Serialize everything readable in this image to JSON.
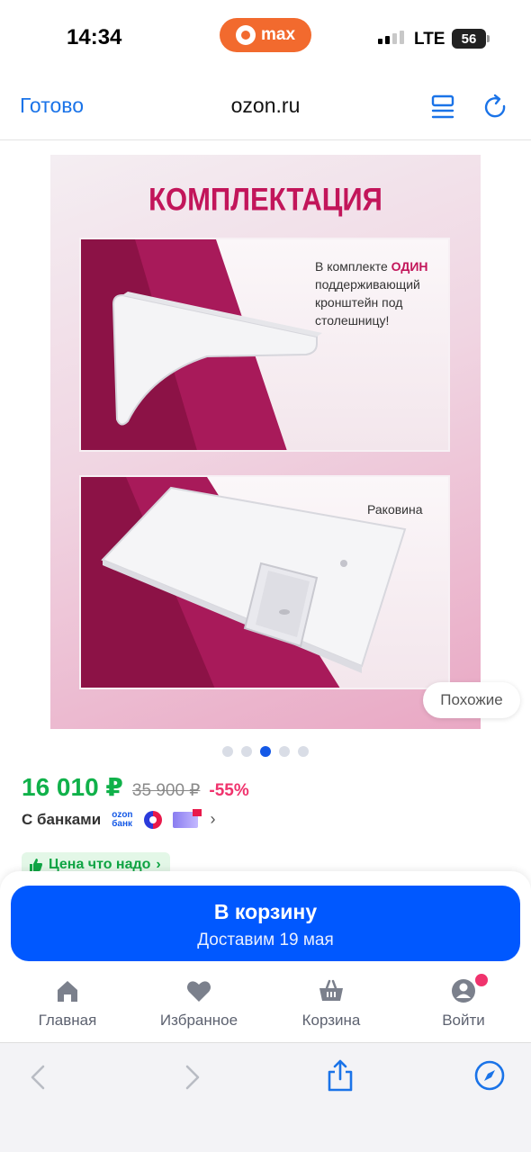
{
  "status_bar": {
    "time": "14:34",
    "app_pill": "max",
    "network": "LTE",
    "battery": "56"
  },
  "browser": {
    "done_label": "Готово",
    "url": "ozon.ru"
  },
  "product_image": {
    "title": "КОМПЛЕКТАЦИЯ",
    "panel1_text_before": "В комплекте ",
    "panel1_text_accent": "ОДИН",
    "panel1_text_after": " поддерживающий кронштейн под столешницу!",
    "panel2_text": "Раковина",
    "similar_label": "Похожие",
    "slide_count": 5,
    "active_slide": 3
  },
  "price": {
    "current": "16 010 ₽",
    "old": "35 900 ₽",
    "discount": "-55%"
  },
  "banks": {
    "label": "С банками",
    "ozon_bank_line1": "ozon",
    "ozon_bank_line2": "банк"
  },
  "badge": {
    "label": "Цена что надо"
  },
  "cart_button": {
    "title": "В корзину",
    "subtitle": "Доставим 19 мая"
  },
  "tabs": [
    {
      "label": "Главная",
      "icon": "home-icon"
    },
    {
      "label": "Избранное",
      "icon": "heart-icon"
    },
    {
      "label": "Корзина",
      "icon": "basket-icon"
    },
    {
      "label": "Войти",
      "icon": "user-icon"
    }
  ],
  "colors": {
    "accent_blue": "#0058ff",
    "price_green": "#10b14a",
    "discount_pink": "#f0336d",
    "safari_blue": "#1a73e8"
  }
}
